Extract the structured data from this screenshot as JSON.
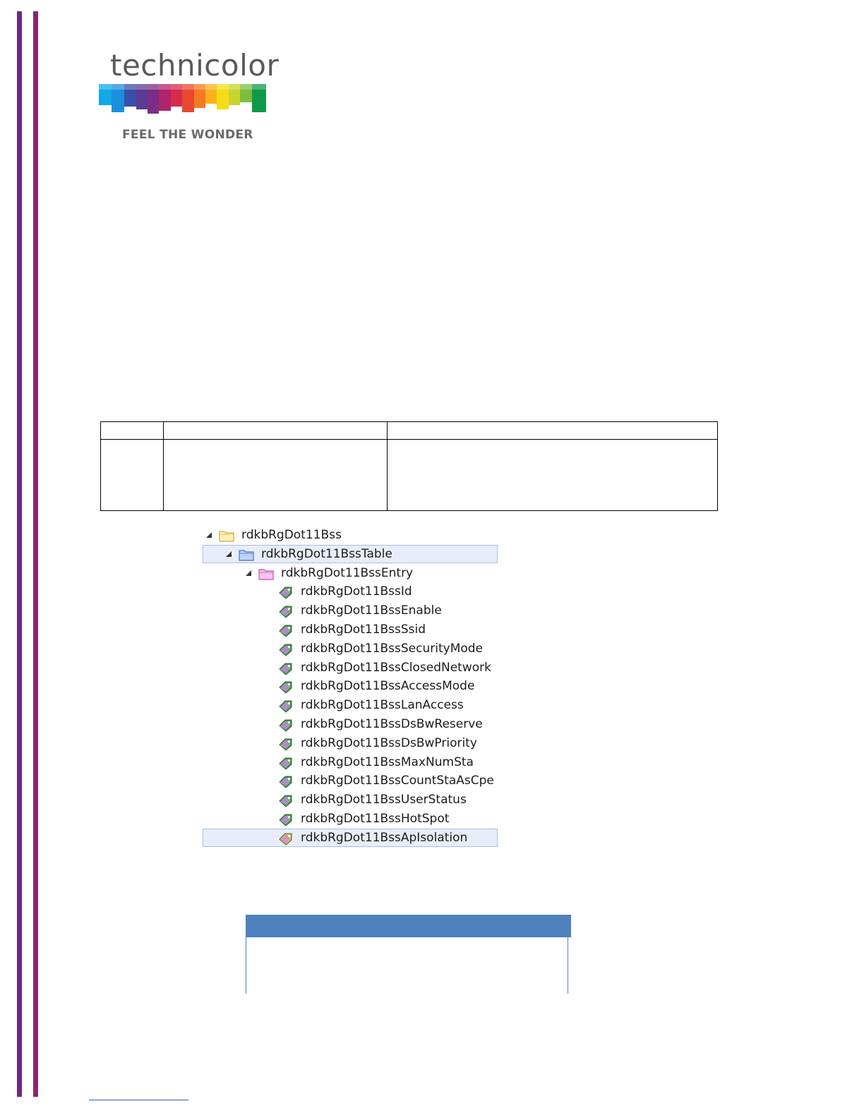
{
  "logo": {
    "brand_name": "technicolor",
    "tagline": "FEEL THE WONDER"
  },
  "colors": {
    "left_bar": "#6c2a83",
    "right_bar": "#86266f",
    "table_header_blue": "#4f81bd",
    "tree_highlight": "#e7eef9"
  },
  "mib_tree": [
    {
      "label": "rdkbRgDot11Bss",
      "icon": "folder-yellow-icon",
      "level": 0,
      "expanded": true,
      "highlighted": false
    },
    {
      "label": "rdkbRgDot11BssTable",
      "icon": "folder-blue-icon",
      "level": 1,
      "expanded": true,
      "highlighted": true
    },
    {
      "label": "rdkbRgDot11BssEntry",
      "icon": "folder-pink-icon",
      "level": 2,
      "expanded": true,
      "highlighted": false
    },
    {
      "label": "rdkbRgDot11BssId",
      "icon": "leaf-object-icon",
      "level": 3,
      "expanded": false,
      "highlighted": false
    },
    {
      "label": "rdkbRgDot11BssEnable",
      "icon": "leaf-object-icon",
      "level": 3,
      "expanded": false,
      "highlighted": false
    },
    {
      "label": "rdkbRgDot11BssSsid",
      "icon": "leaf-object-icon",
      "level": 3,
      "expanded": false,
      "highlighted": false
    },
    {
      "label": "rdkbRgDot11BssSecurityMode",
      "icon": "leaf-object-icon",
      "level": 3,
      "expanded": false,
      "highlighted": false
    },
    {
      "label": "rdkbRgDot11BssClosedNetwork",
      "icon": "leaf-object-icon",
      "level": 3,
      "expanded": false,
      "highlighted": false
    },
    {
      "label": "rdkbRgDot11BssAccessMode",
      "icon": "leaf-object-icon",
      "level": 3,
      "expanded": false,
      "highlighted": false
    },
    {
      "label": "rdkbRgDot11BssLanAccess",
      "icon": "leaf-object-icon",
      "level": 3,
      "expanded": false,
      "highlighted": false
    },
    {
      "label": "rdkbRgDot11BssDsBwReserve",
      "icon": "leaf-object-icon",
      "level": 3,
      "expanded": false,
      "highlighted": false
    },
    {
      "label": "rdkbRgDot11BssDsBwPriority",
      "icon": "leaf-object-icon",
      "level": 3,
      "expanded": false,
      "highlighted": false
    },
    {
      "label": "rdkbRgDot11BssMaxNumSta",
      "icon": "leaf-object-icon",
      "level": 3,
      "expanded": false,
      "highlighted": false
    },
    {
      "label": "rdkbRgDot11BssCountStaAsCpe",
      "icon": "leaf-object-icon",
      "level": 3,
      "expanded": false,
      "highlighted": false
    },
    {
      "label": "rdkbRgDot11BssUserStatus",
      "icon": "leaf-object-icon",
      "level": 3,
      "expanded": false,
      "highlighted": false
    },
    {
      "label": "rdkbRgDot11BssHotSpot",
      "icon": "leaf-object-icon",
      "level": 3,
      "expanded": false,
      "highlighted": false
    },
    {
      "label": "rdkbRgDot11BssApIsolation",
      "icon": "leaf-object-selected-icon",
      "level": 3,
      "expanded": false,
      "highlighted": true
    }
  ]
}
